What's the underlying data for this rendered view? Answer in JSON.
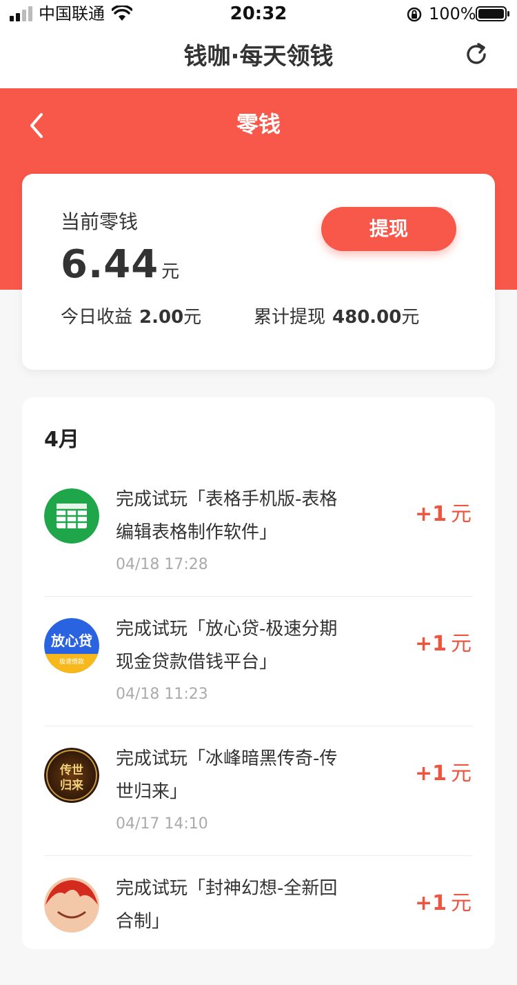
{
  "status_bar": {
    "carrier": "中国联通",
    "time": "20:32",
    "battery": "100%"
  },
  "header": {
    "title": "钱咖·每天领钱",
    "refresh_icon": "refresh-icon"
  },
  "banner": {
    "title": "零钱",
    "back_icon": "chevron-left-icon"
  },
  "balance": {
    "label": "当前零钱",
    "amount": "6.44",
    "unit": "元",
    "withdraw_button": "提现",
    "today_label": "今日收益",
    "today_value": "2.00",
    "today_unit": "元",
    "total_label": "累计提现",
    "total_value": "480.00",
    "total_unit": "元"
  },
  "records": {
    "month": "4月",
    "items": [
      {
        "line1": "完成试玩「表格手机版-表格",
        "line2": "编辑表格制作软件」",
        "time": "04/18 17:28",
        "reward": "+1",
        "unit": "元",
        "icon": "spreadsheet-app-icon"
      },
      {
        "line1": "完成试玩「放心贷-极速分期",
        "line2": "现金贷款借钱平台」",
        "time": "04/18 11:23",
        "reward": "+1",
        "unit": "元",
        "icon": "loan-app-icon",
        "icon_text": "放心贷",
        "icon_subtext": "极速借款"
      },
      {
        "line1": "完成试玩「冰峰暗黑传奇-传",
        "line2": "世归来」",
        "time": "04/17 14:10",
        "reward": "+1",
        "unit": "元",
        "icon": "game-app-icon",
        "icon_text": "传世归来"
      },
      {
        "line1": "完成试玩「封神幻想-全新回",
        "line2": "合制」",
        "time": "",
        "reward": "+1",
        "unit": "元",
        "icon": "fantasy-game-app-icon"
      }
    ]
  },
  "colors": {
    "accent": "#f8584a",
    "reward": "#f0543f",
    "background": "#f7f7f7"
  }
}
